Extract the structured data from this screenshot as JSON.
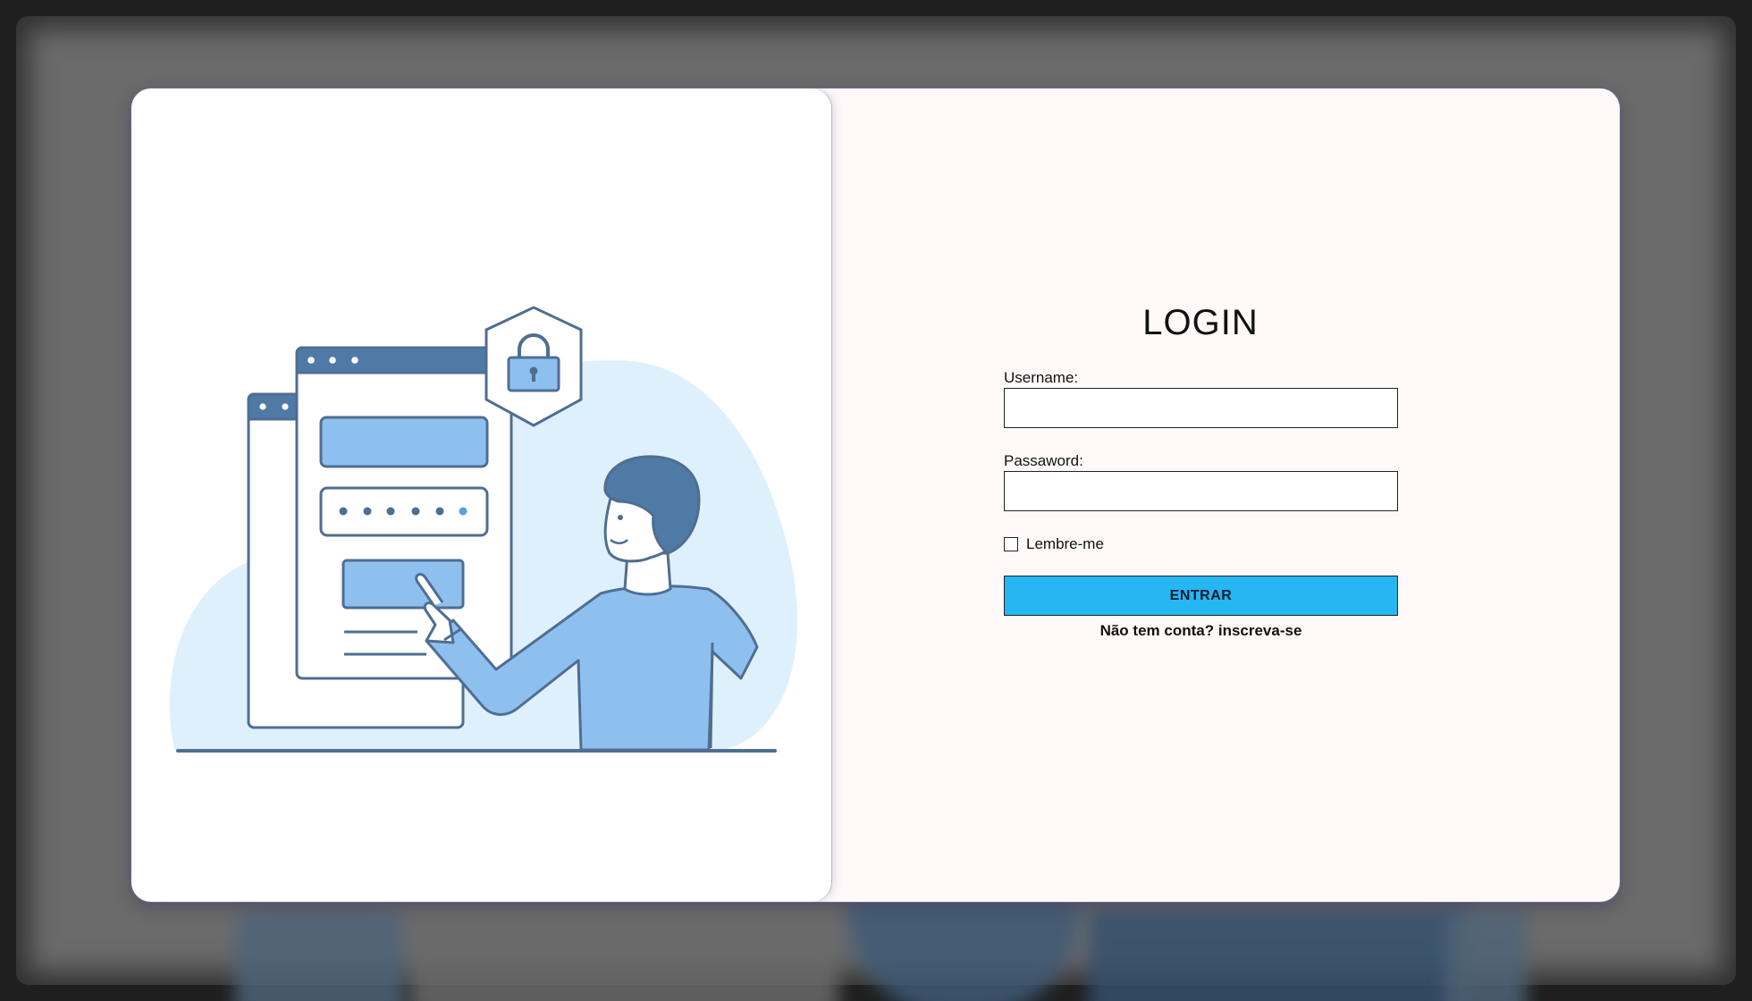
{
  "login": {
    "title": "LOGIN",
    "username_label": "Username:",
    "username_value": "",
    "password_label": "Passaword:",
    "password_value": "",
    "remember_label": "Lembre-me",
    "remember_checked": false,
    "submit_label": "ENTRAR",
    "signup_text": "Não tem conta?",
    "signup_link": "inscreva-se"
  },
  "illustration": {
    "subject": "person-clicking-login-form",
    "icons": [
      "browser-window-icon",
      "lock-shield-icon"
    ]
  },
  "colors": {
    "submit_button": "#26b6f1",
    "card_right_background": "#fffaf9",
    "illustration_primary": "#4f7aa6",
    "illustration_light": "#8ec0ef",
    "illustration_blob": "#dff0fd",
    "backdrop": "#6b6b6b"
  }
}
